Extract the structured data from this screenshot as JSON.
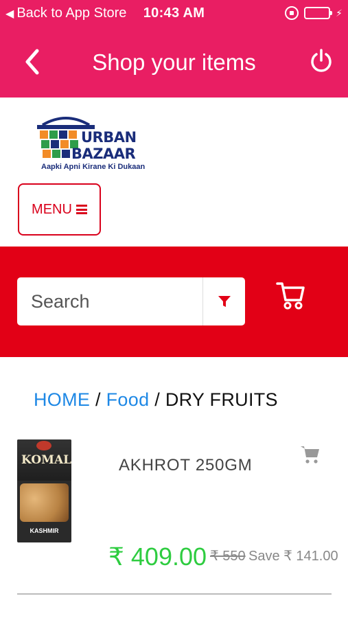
{
  "status_bar": {
    "back_label": "Back to App Store",
    "time": "10:43 AM",
    "battery_color": "#4cd964"
  },
  "header": {
    "title": "Shop your items",
    "back_icon": "chevron-left-icon",
    "power_icon": "power-icon",
    "color": "#e91e63"
  },
  "logo": {
    "brand_line1": "URBAN",
    "brand_line2": "BAZAAR",
    "tagline": "Aapki Apni Kirane Ki Dukaan"
  },
  "menu": {
    "label": "MENU",
    "icon": "hamburger-icon"
  },
  "search": {
    "placeholder": "Search",
    "filter_icon": "filter-icon",
    "cart_icon": "cart-icon",
    "band_color": "#e20016"
  },
  "breadcrumb": {
    "items": [
      "HOME",
      "Food",
      "DRY FRUITS"
    ],
    "separator": "/"
  },
  "product": {
    "name": "AKHROT 250GM",
    "image_brand": "KOMAL",
    "image_caption": "KASHMIR",
    "price": "₹ 409.00",
    "mrp": "₹ 550",
    "save": "Save ₹ 141.00",
    "price_color": "#2ecc40",
    "add_to_cart_icon": "cart-icon"
  }
}
